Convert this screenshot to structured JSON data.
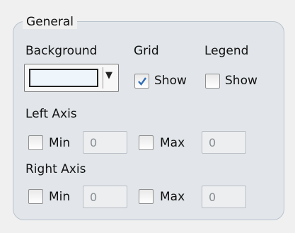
{
  "group": {
    "title": "General"
  },
  "background": {
    "label": "Background"
  },
  "grid": {
    "label": "Grid",
    "show_label": "Show",
    "checked": true
  },
  "legend": {
    "label": "Legend",
    "show_label": "Show",
    "checked": false
  },
  "left_axis": {
    "label": "Left Axis",
    "min_label": "Min",
    "min_checked": false,
    "min_value": "0",
    "max_label": "Max",
    "max_checked": false,
    "max_value": "0"
  },
  "right_axis": {
    "label": "Right Axis",
    "min_label": "Min",
    "min_checked": false,
    "min_value": "0",
    "max_label": "Max",
    "max_checked": false,
    "max_value": "0"
  },
  "icons": {
    "dropdown": "chevron-down-icon",
    "check": "checkmark-icon"
  },
  "colors": {
    "check": "#2f6db5",
    "panel": "#e2e6ea"
  }
}
